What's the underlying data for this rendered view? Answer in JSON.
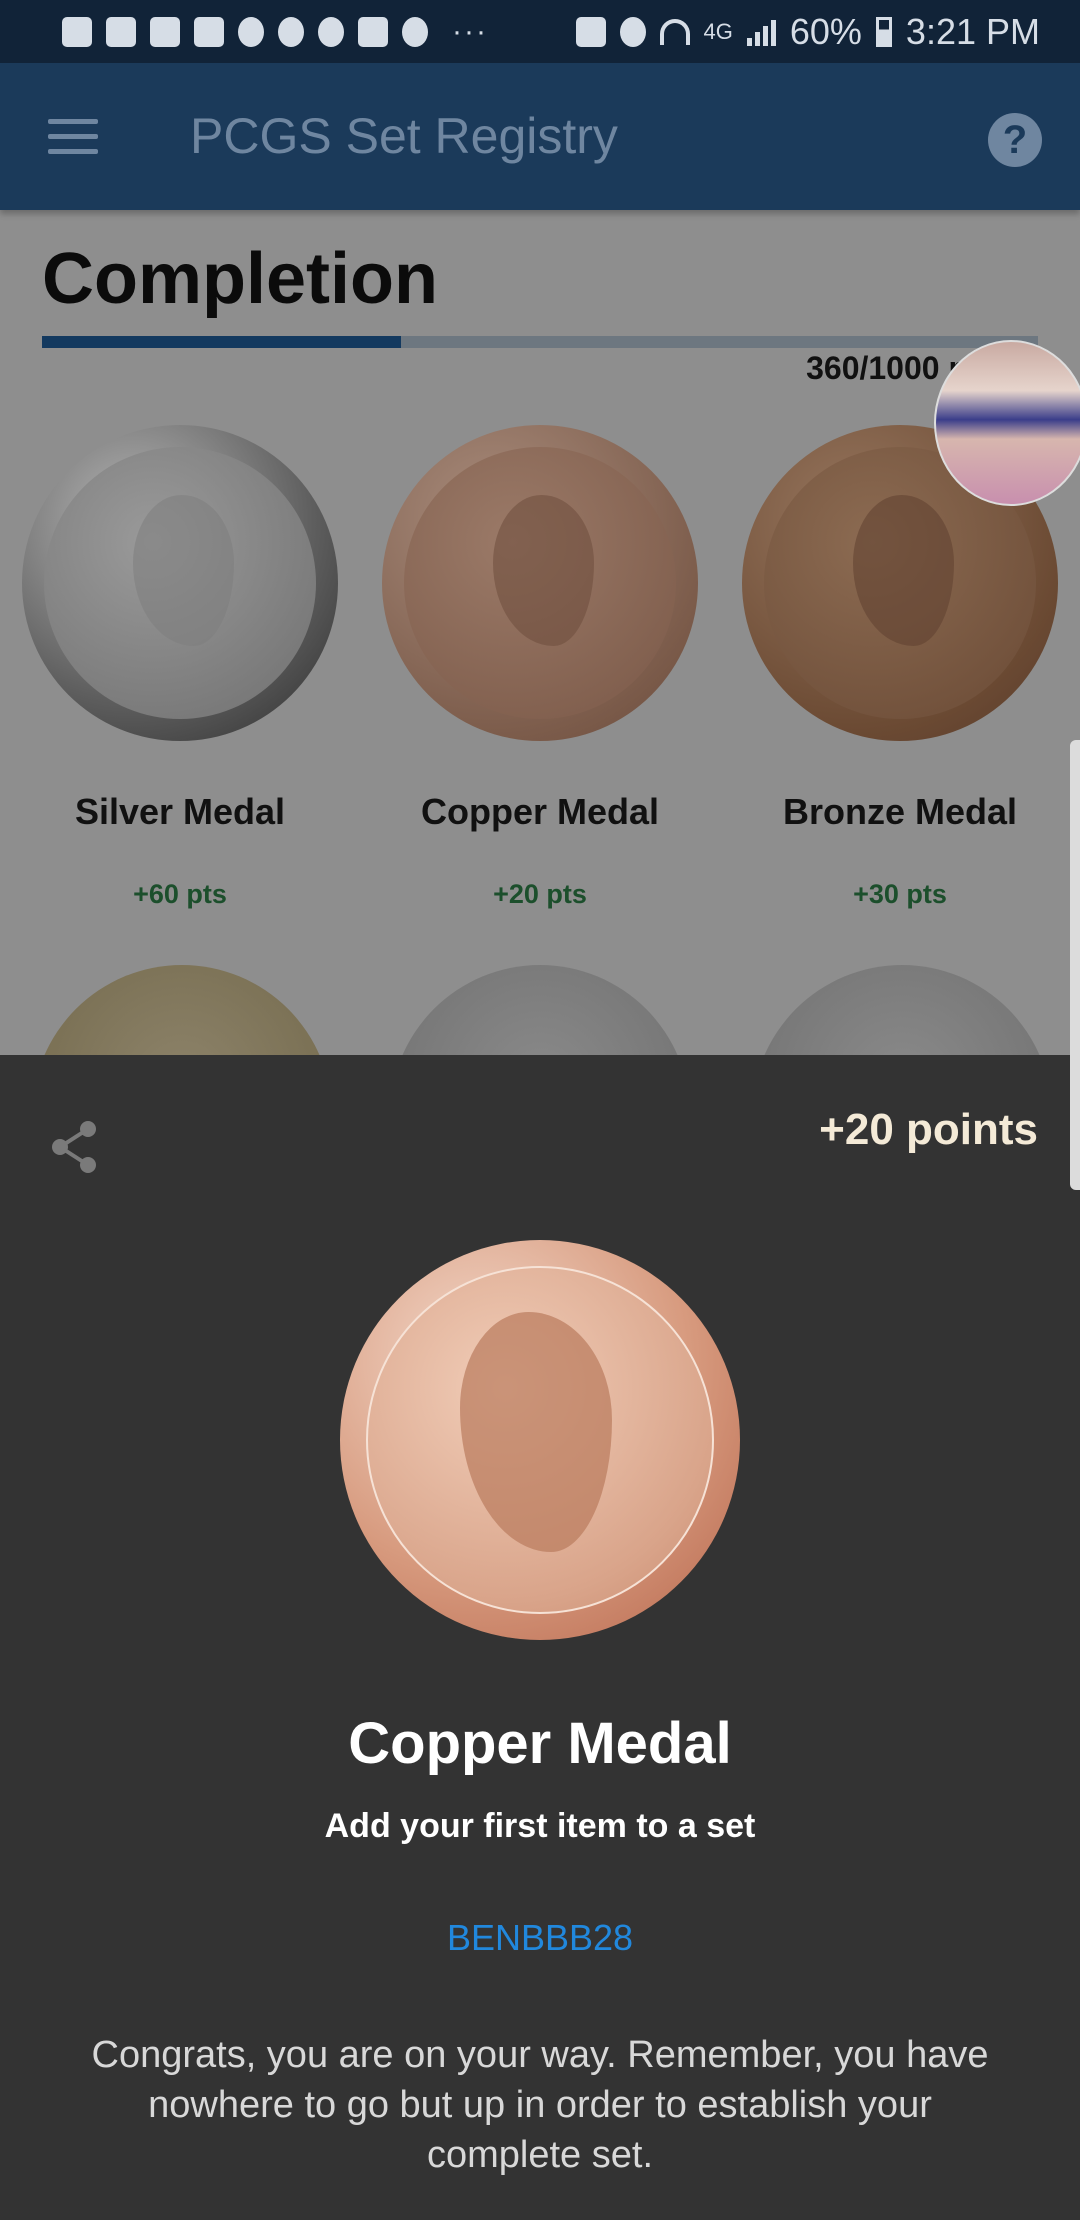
{
  "status_bar": {
    "dots": "···",
    "network": "4G",
    "battery": "60%",
    "time": "3:21 PM"
  },
  "app_bar": {
    "title": "PCGS Set Registry",
    "help_label": "?"
  },
  "page": {
    "title": "Completion",
    "progress_label": "360/1000 p",
    "progress_fraction": 0.36
  },
  "medals": [
    {
      "name": "Silver Medal",
      "points": "+60 pts",
      "style": "silver"
    },
    {
      "name": "Copper Medal",
      "points": "+20 pts",
      "style": "copper"
    },
    {
      "name": "Bronze Medal",
      "points": "+30 pts",
      "style": "bronze"
    }
  ],
  "sheet": {
    "points": "+20 points",
    "medal_title": "Copper Medal",
    "medal_subtitle": "Add your first item to a set",
    "username": "BENBBB28",
    "message": "Congrats, you are on your way. Remember, you have nowhere to go but up in order to establish your complete set."
  },
  "icons": {
    "menu": "hamburger-menu-icon",
    "help": "help-icon",
    "share": "share-icon"
  },
  "colors": {
    "app_bar": "#1b3a5a",
    "status_bar": "#112338",
    "sheet": "#333333",
    "link": "#2188dd",
    "points_green": "#1c4f2c"
  }
}
